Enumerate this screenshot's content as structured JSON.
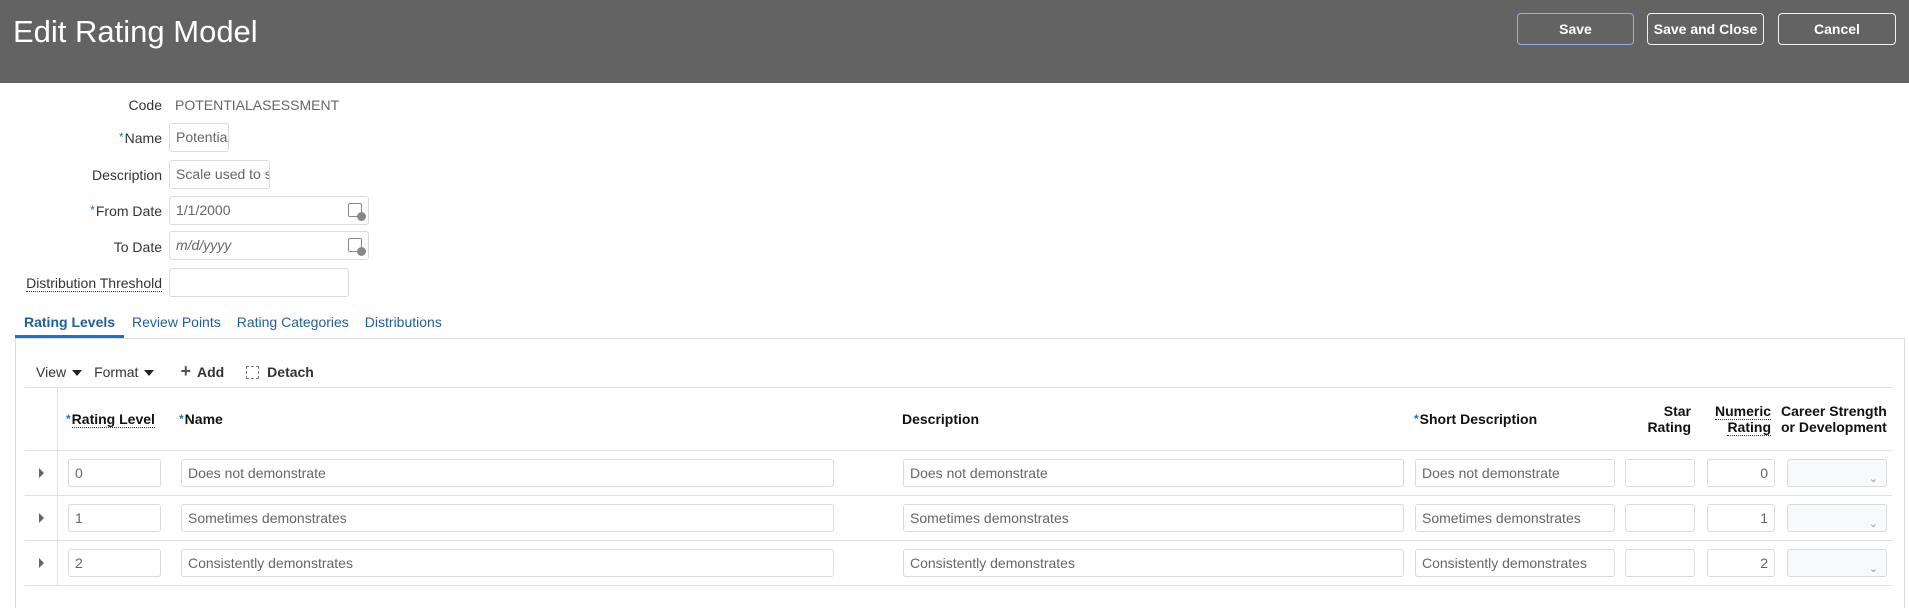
{
  "header": {
    "title": "Edit Rating Model",
    "save": "Save",
    "save_close": "Save and Close",
    "cancel": "Cancel"
  },
  "form": {
    "code_label": "Code",
    "code_value": "POTENTIALASESSMENT",
    "name_label": "Name",
    "name_value": "Potentia",
    "description_label": "Description",
    "description_value": "Scale used to s",
    "from_date_label": "From Date",
    "from_date_value": "1/1/2000",
    "to_date_label": "To Date",
    "to_date_placeholder": "m/d/yyyy",
    "threshold_label": "Distribution Threshold",
    "threshold_value": "",
    "required_mark": "*"
  },
  "tabs": [
    "Rating Levels",
    "Review Points",
    "Rating Categories",
    "Distributions"
  ],
  "toolbar": {
    "view": "View",
    "format": "Format",
    "add": "Add",
    "detach": "Detach"
  },
  "table": {
    "headers": {
      "rating_level": "Rating Level",
      "name": "Name",
      "description": "Description",
      "short_description": "Short Description",
      "star_rating": "Star Rating",
      "numeric_rating": "Numeric Rating",
      "career": "Career Strength or Development"
    },
    "rows": [
      {
        "rating_level": "0",
        "name": "Does not demonstrate",
        "description": "Does not demonstrate",
        "short_description": "Does not demonstrate",
        "star_rating": "",
        "numeric_rating": "0",
        "career": ""
      },
      {
        "rating_level": "1",
        "name": "Sometimes demonstrates",
        "description": "Sometimes demonstrates",
        "short_description": "Sometimes demonstrates",
        "star_rating": "",
        "numeric_rating": "1",
        "career": ""
      },
      {
        "rating_level": "2",
        "name": "Consistently demonstrates",
        "description": "Consistently demonstrates",
        "short_description": "Consistently demonstrates",
        "star_rating": "",
        "numeric_rating": "2",
        "career": ""
      }
    ]
  }
}
